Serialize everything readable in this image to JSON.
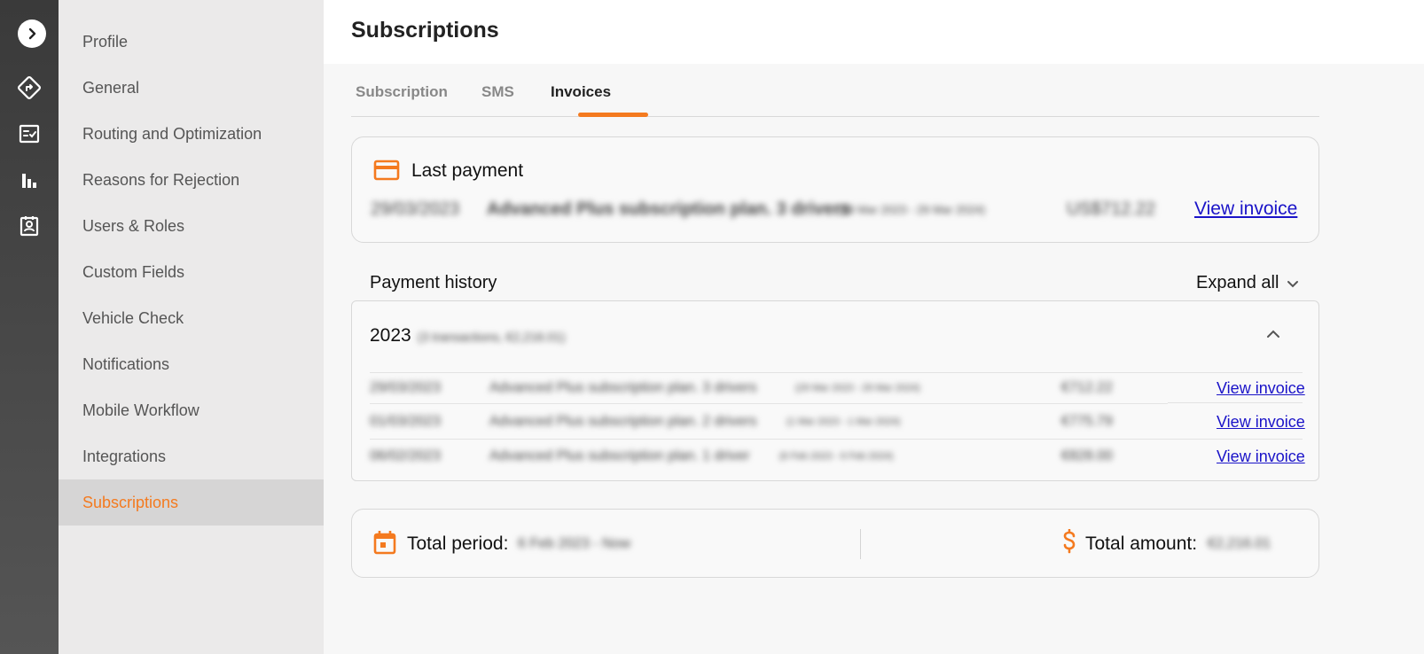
{
  "rail": {
    "icons": [
      "chevron-right-icon",
      "route-icon",
      "checklist-icon",
      "bar-chart-icon",
      "contact-card-icon"
    ]
  },
  "menu": {
    "items": [
      {
        "label": "Profile"
      },
      {
        "label": "General"
      },
      {
        "label": "Routing and Optimization"
      },
      {
        "label": "Reasons for Rejection"
      },
      {
        "label": "Users & Roles"
      },
      {
        "label": "Custom Fields"
      },
      {
        "label": "Vehicle Check"
      },
      {
        "label": "Notifications"
      },
      {
        "label": "Mobile Workflow"
      },
      {
        "label": "Integrations"
      },
      {
        "label": "Subscriptions"
      }
    ],
    "active_index": 10
  },
  "page": {
    "title": "Subscriptions"
  },
  "tabs": [
    {
      "label": "Subscription"
    },
    {
      "label": "SMS"
    },
    {
      "label": "Invoices"
    }
  ],
  "last_payment": {
    "title": "Last payment",
    "date": "29/03/2023",
    "description": "Advanced Plus subscription plan. 3 drivers",
    "period": "(29 Mar 2023 - 29 Mar 2024)",
    "amount": "US$712.22",
    "link": "View invoice"
  },
  "history": {
    "title": "Payment history",
    "expand_label": "Expand all",
    "year": "2023",
    "year_meta": "(3 transactions, €2,216.01)",
    "rows": [
      {
        "date": "29/03/2023",
        "description": "Advanced Plus subscription plan. 3 drivers",
        "period": "(29 Mar 2023 - 29 Mar 2024)",
        "amount": "€712.22",
        "link": "View invoice"
      },
      {
        "date": "01/03/2023",
        "description": "Advanced Plus subscription plan. 2 drivers",
        "period": "(1 Mar 2023 - 1 Mar 2024)",
        "amount": "€775.79",
        "link": "View invoice"
      },
      {
        "date": "06/02/2023",
        "description": "Advanced Plus subscription plan. 1 driver",
        "period": "(6 Feb 2023 - 6 Feb 2024)",
        "amount": "€828.00",
        "link": "View invoice"
      }
    ]
  },
  "totals": {
    "period_label": "Total period:",
    "period_value": "6 Feb 2023 - Now",
    "amount_label": "Total amount:",
    "amount_value": "€2,216.01"
  },
  "colors": {
    "accent": "#f47a1f",
    "link": "#1a13c8"
  }
}
